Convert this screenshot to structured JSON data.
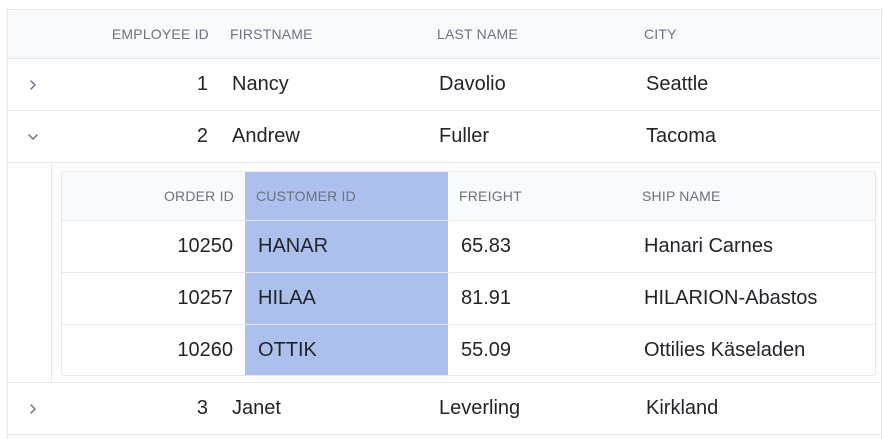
{
  "grid": {
    "columns": [
      "EMPLOYEE ID",
      "FIRSTNAME",
      "LAST NAME",
      "CITY"
    ],
    "rows": [
      {
        "employee_id": "1",
        "first_name": "Nancy",
        "last_name": "Davolio",
        "city": "Seattle",
        "expanded": false
      },
      {
        "employee_id": "2",
        "first_name": "Andrew",
        "last_name": "Fuller",
        "city": "Tacoma",
        "expanded": true
      },
      {
        "employee_id": "3",
        "first_name": "Janet",
        "last_name": "Leverling",
        "city": "Kirkland",
        "expanded": false
      }
    ]
  },
  "child_grid": {
    "columns": [
      "ORDER ID",
      "CUSTOMER ID",
      "FREIGHT",
      "SHIP NAME"
    ],
    "selected_column": "CUSTOMER ID",
    "selection_color": "#adc0ed",
    "rows": [
      {
        "order_id": "10250",
        "customer_id": "HANAR",
        "freight": "65.83",
        "ship_name": "Hanari Carnes"
      },
      {
        "order_id": "10257",
        "customer_id": "HILAA",
        "freight": "81.91",
        "ship_name": "HILARION-Abastos"
      },
      {
        "order_id": "10260",
        "customer_id": "OTTIK",
        "freight": "55.09",
        "ship_name": "Ottilies Käseladen"
      }
    ]
  },
  "icons": {
    "collapsed": "chevron-right-icon",
    "expanded": "chevron-down-icon"
  }
}
